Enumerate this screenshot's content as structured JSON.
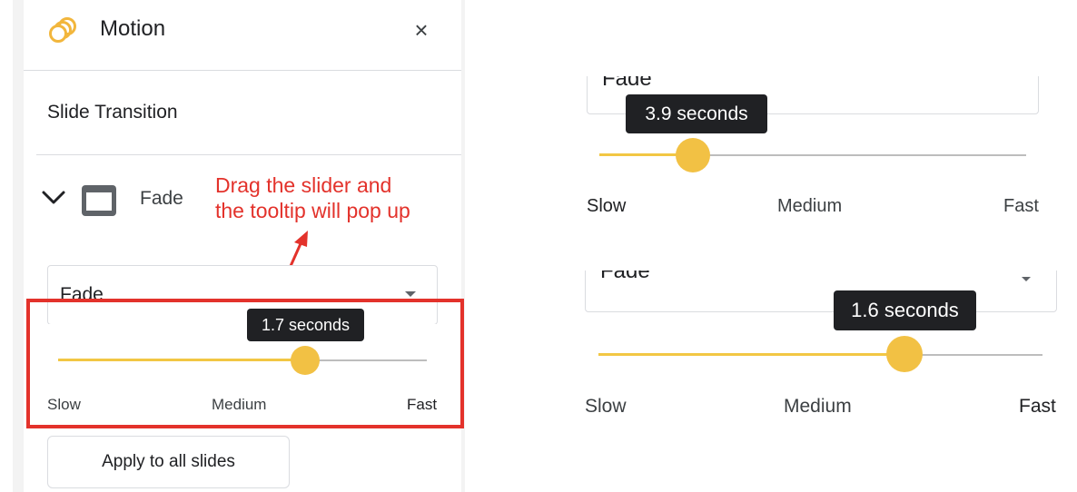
{
  "panel": {
    "title": "Motion",
    "close_label": "×",
    "section_title": "Slide Transition",
    "transition": {
      "name": "Fade",
      "select_value": "Fade"
    },
    "slider": {
      "tooltip": "1.7 seconds",
      "position": 0.67,
      "labels": {
        "slow": "Slow",
        "medium": "Medium",
        "fast": "Fast"
      }
    },
    "apply_button": "Apply to all slides"
  },
  "annotation": {
    "text": "Drag the slider and\nthe tooltip will pop up",
    "color": "#e3322b"
  },
  "examples": [
    {
      "select_value": "Fade",
      "slider": {
        "tooltip": "3.9 seconds",
        "position": 0.22,
        "labels": {
          "slow": "Slow",
          "medium": "Medium",
          "fast": "Fast"
        }
      }
    },
    {
      "select_value": "Fade",
      "slider": {
        "tooltip": "1.6 seconds",
        "position": 0.69,
        "labels": {
          "slow": "Slow",
          "medium": "Medium",
          "fast": "Fast"
        }
      }
    }
  ],
  "colors": {
    "accent": "#f2c144",
    "tooltip_bg": "#202124",
    "highlight": "#e3322b"
  },
  "icons": {
    "app": "motion-rings-icon",
    "close": "close-icon",
    "expand": "chevron-down-icon",
    "slide": "slide-thumbnail-icon",
    "dropdown": "dropdown-caret-icon"
  }
}
